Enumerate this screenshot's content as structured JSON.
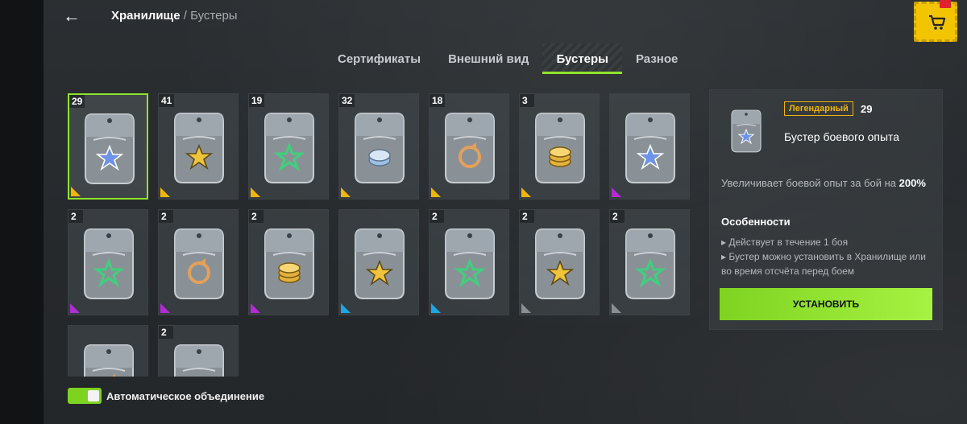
{
  "header": {
    "title": "Хранилище",
    "separator": "/",
    "subtitle": "Бустеры",
    "back_icon": "←"
  },
  "tabs": [
    {
      "label": "Сертификаты",
      "active": false
    },
    {
      "label": "Внешний вид",
      "active": false
    },
    {
      "label": "Бустеры",
      "active": true
    },
    {
      "label": "Разное",
      "active": false
    }
  ],
  "rarity_colors": {
    "legendary": "#f1b40a",
    "epic": "#b22bd7",
    "rare": "#1ea5e6",
    "common": "#8a8f93"
  },
  "icon_colors": {
    "xp": "#6f93e8",
    "credits": "#f0c33c",
    "crew": "#3fd07d",
    "free": "#9ec0e4",
    "gold": "#e3b23c",
    "repair": "#e5a05a"
  },
  "items": [
    {
      "count": "29",
      "type": "xp",
      "rarity": "legendary",
      "selected": true
    },
    {
      "count": "41",
      "type": "credits",
      "rarity": "legendary"
    },
    {
      "count": "19",
      "type": "crew",
      "rarity": "legendary"
    },
    {
      "count": "32",
      "type": "free",
      "rarity": "legendary"
    },
    {
      "count": "18",
      "type": "repair",
      "rarity": "legendary"
    },
    {
      "count": "3",
      "type": "gold",
      "rarity": "legendary"
    },
    {
      "count": "",
      "type": "xp",
      "rarity": "epic"
    },
    {
      "count": "2",
      "type": "crew",
      "rarity": "epic"
    },
    {
      "count": "2",
      "type": "repair",
      "rarity": "epic"
    },
    {
      "count": "2",
      "type": "gold",
      "rarity": "epic"
    },
    {
      "count": "",
      "type": "credits",
      "rarity": "rare"
    },
    {
      "count": "2",
      "type": "crew",
      "rarity": "rare"
    },
    {
      "count": "2",
      "type": "credits",
      "rarity": "common"
    },
    {
      "count": "2",
      "type": "crew",
      "rarity": "common"
    },
    {
      "count": "",
      "type": "repair",
      "rarity": "common"
    },
    {
      "count": "2",
      "type": "free",
      "rarity": "common"
    }
  ],
  "auto_merge": {
    "label": "Автоматическое объединение",
    "enabled": true
  },
  "detail": {
    "rarity": "Легендарный",
    "count": "29",
    "title": "Бустер боевого опыта",
    "desc_prefix": "Увеличивает боевой опыт за бой на ",
    "desc_value": "200%",
    "features_heading": "Особенности",
    "features": [
      "Действует в течение 1 боя",
      "Бустер можно установить в Хранилище или во время отсчёта перед боем"
    ],
    "install_label": "УСТАНОВИТЬ"
  }
}
